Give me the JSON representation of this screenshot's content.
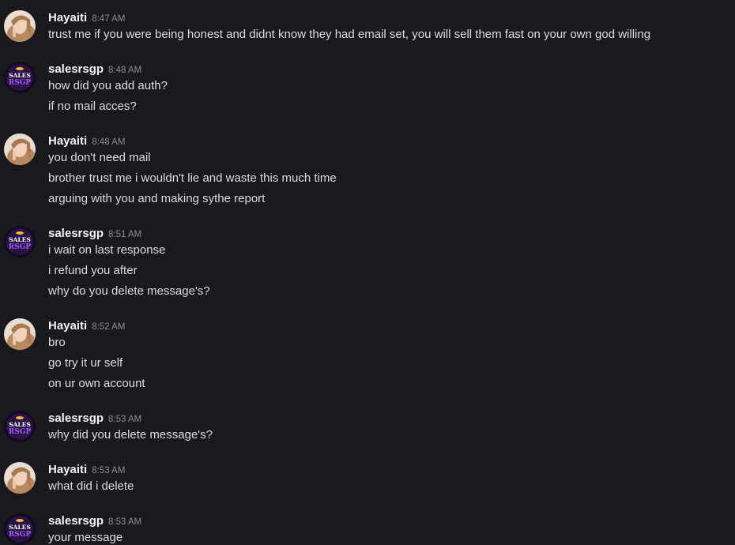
{
  "users": {
    "hayaiti": {
      "name": "Hayaiti",
      "avatar_icon": "woman-portrait-avatar"
    },
    "salesrsgp": {
      "name": "salesrsgp",
      "avatar_icon": "sales-rsgp-logo-avatar",
      "avatar_text_top": "SALES",
      "avatar_text_bottom": "RSGP"
    }
  },
  "groups": [
    {
      "user": "Hayaiti",
      "time": "8:47 AM",
      "messages": [
        "trust me if you were being honest and didnt know they had email set, you will sell them fast on your own god willing"
      ]
    },
    {
      "user": "salesrsgp",
      "time": "8:48 AM",
      "messages": [
        "how did you add auth?",
        "if no mail acces?"
      ]
    },
    {
      "user": "Hayaiti",
      "time": "8:48 AM",
      "messages": [
        "you don't need mail",
        "brother trust me i wouldn't lie and waste this much time",
        "arguing with you and making sythe report"
      ]
    },
    {
      "user": "salesrsgp",
      "time": "8:51 AM",
      "messages": [
        "i wait on last response",
        "i refund you after",
        "why do you delete message's?"
      ]
    },
    {
      "user": "Hayaiti",
      "time": "8:52 AM",
      "messages": [
        "bro",
        "go try it ur self",
        "on ur own account"
      ]
    },
    {
      "user": "salesrsgp",
      "time": "8:53 AM",
      "messages": [
        "why did you delete message's?"
      ]
    },
    {
      "user": "Hayaiti",
      "time": "8:53 AM",
      "messages": [
        "what did i delete"
      ]
    },
    {
      "user": "salesrsgp",
      "time": "8:53 AM",
      "messages": [
        "your message"
      ]
    }
  ]
}
